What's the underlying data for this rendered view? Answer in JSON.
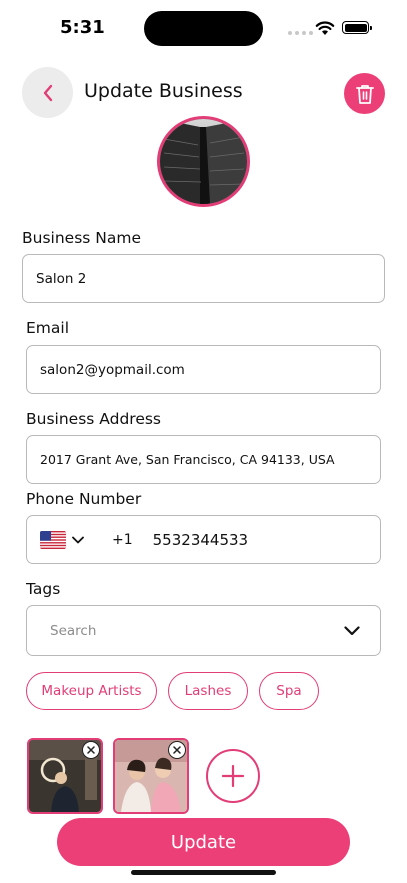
{
  "status_bar": {
    "time": "5:31"
  },
  "header": {
    "title": "Update Business"
  },
  "form": {
    "business_name": {
      "label": "Business Name",
      "value": "Salon 2"
    },
    "email": {
      "label": "Email",
      "value": "salon2@yopmail.com"
    },
    "address": {
      "label": "Business Address",
      "value": "2017 Grant Ave, San Francisco, CA 94133, USA"
    },
    "phone": {
      "label": "Phone Number",
      "country_code": "+1",
      "number": "5532344533"
    },
    "tags": {
      "label": "Tags",
      "placeholder": "Search",
      "selected": [
        "Makeup Artists",
        "Lashes",
        "Spa"
      ]
    }
  },
  "actions": {
    "update_label": "Update"
  },
  "colors": {
    "accent": "#ec3f78",
    "border": "#b9b9b9"
  }
}
